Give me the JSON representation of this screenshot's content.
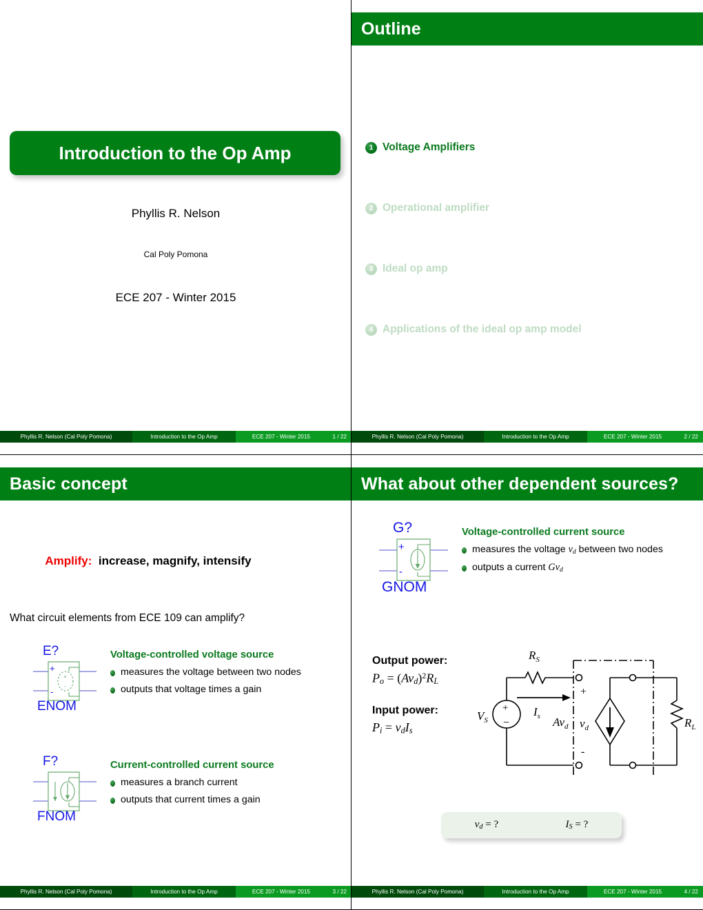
{
  "deck": {
    "author": "Phyllis R. Nelson",
    "author_footer": "Phyllis R. Nelson  (Cal Poly Pomona)",
    "institution": "Cal Poly Pomona",
    "short_title": "Introduction to the Op Amp",
    "course": "ECE 207 - Winter 2015",
    "total_frames": "22",
    "accent_green": "#008014",
    "dark_green": "#004b0b",
    "mid_green": "#00660f",
    "bright_green": "#0b9b22",
    "list_green": "#0a7a1e",
    "dim_green": "#bfdcc3",
    "red": "#ef0000",
    "symbol_blue": "#1414e6"
  },
  "slide1": {
    "title": "Introduction to the Op Amp",
    "author": "Phyllis R. Nelson",
    "institution": "Cal Poly Pomona",
    "course": "ECE 207 - Winter 2015",
    "page": "1 / 22"
  },
  "slide2": {
    "header": "Outline",
    "page": "2 / 22",
    "items": [
      {
        "num": "1",
        "label": "Voltage Amplifiers",
        "active": true
      },
      {
        "num": "2",
        "label": "Operational amplifier",
        "active": false
      },
      {
        "num": "3",
        "label": "Ideal op amp",
        "active": false
      },
      {
        "num": "4",
        "label": "Applications of the ideal op amp model",
        "active": false
      }
    ]
  },
  "slide3": {
    "header": "Basic concept",
    "page": "3 / 22",
    "amplify_label": "Amplify:",
    "amplify_text": "increase, magnify, intensify",
    "question": "What circuit elements from ECE 109 can amplify?",
    "e_symbol": {
      "ref": "E?",
      "name": "ENOM",
      "plus": "+",
      "minus": "-"
    },
    "f_symbol": {
      "ref": "F?",
      "name": "FNOM"
    },
    "groups": [
      {
        "title": "Voltage-controlled voltage source",
        "bullets": [
          "measures the voltage between two nodes",
          "outputs that voltage times a gain"
        ]
      },
      {
        "title": "Current-controlled current source",
        "bullets": [
          "measures a branch current",
          "outputs that current times a gain"
        ]
      }
    ]
  },
  "slide4": {
    "header": "What about other dependent sources?",
    "page": "4 / 22",
    "g_symbol": {
      "ref": "G?",
      "name": "GNOM",
      "plus": "+",
      "minus": "-"
    },
    "group": {
      "title": "Voltage-controlled current source",
      "bullets": [
        "measures the voltage v_d between two nodes",
        "outputs a current Gv_d"
      ]
    },
    "output_power_label": "Output power:",
    "output_power_eq": "P_o = (Av_d)^2 R_L",
    "input_power_label": "Input power:",
    "input_power_eq": "P_i = v_d I_s",
    "circuit": {
      "source": "V_S",
      "series_resistor": "R_S",
      "source_current": "I_s",
      "diff_voltage": "v_d",
      "plus": "+",
      "minus": "-",
      "dependent_source": "Av_d",
      "load": "R_L"
    },
    "callout": {
      "left": "v_d = ?",
      "right": "I_S = ?"
    }
  }
}
